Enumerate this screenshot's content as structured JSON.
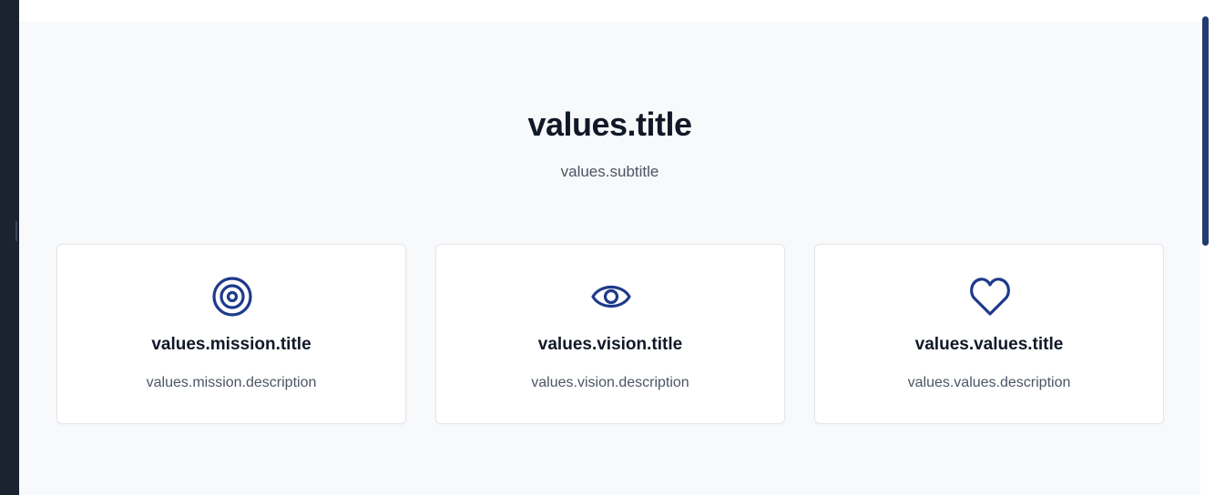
{
  "section": {
    "title": "values.title",
    "subtitle": "values.subtitle"
  },
  "cards": [
    {
      "icon": "target-icon",
      "title": "values.mission.title",
      "description": "values.mission.description"
    },
    {
      "icon": "eye-icon",
      "title": "values.vision.title",
      "description": "values.vision.description"
    },
    {
      "icon": "heart-icon",
      "title": "values.values.title",
      "description": "values.values.description"
    }
  ],
  "colors": {
    "accent": "#1e3a8a",
    "heading": "#111827",
    "body_text": "#4b5563",
    "section_bg": "#f8f9fb",
    "card_bg": "#ffffff",
    "card_border": "#e5e7eb",
    "scrollbar_thumb": "#233b6e"
  }
}
